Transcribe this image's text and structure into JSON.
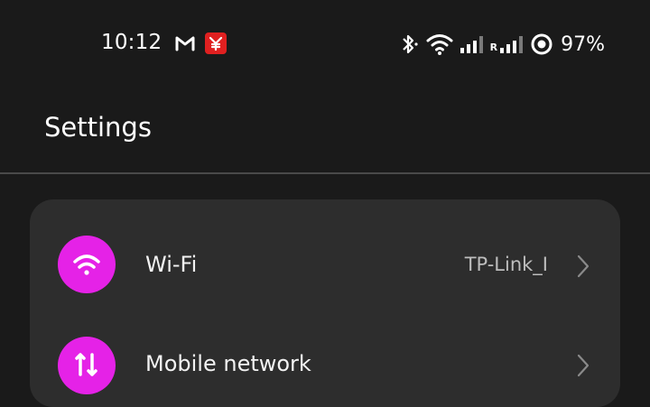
{
  "status_bar": {
    "time": "10:12",
    "battery_percent": "97%",
    "roaming_indicator": "R",
    "icons": [
      "gmail-icon",
      "app-notification-icon",
      "bluetooth-icon",
      "wifi-icon",
      "signal-icon",
      "roaming-signal-icon",
      "battery-ring-icon"
    ]
  },
  "header": {
    "title": "Settings"
  },
  "settings": {
    "items": [
      {
        "label": "Wi-Fi",
        "value": "TP-Link_I",
        "icon": "wifi-icon"
      },
      {
        "label": "Mobile network",
        "value": "",
        "icon": "mobile-network-icon"
      }
    ]
  },
  "colors": {
    "background": "#1a1a1a",
    "card": "#2d2d2d",
    "accent": "#e522e7",
    "notification_red": "#e02020"
  }
}
